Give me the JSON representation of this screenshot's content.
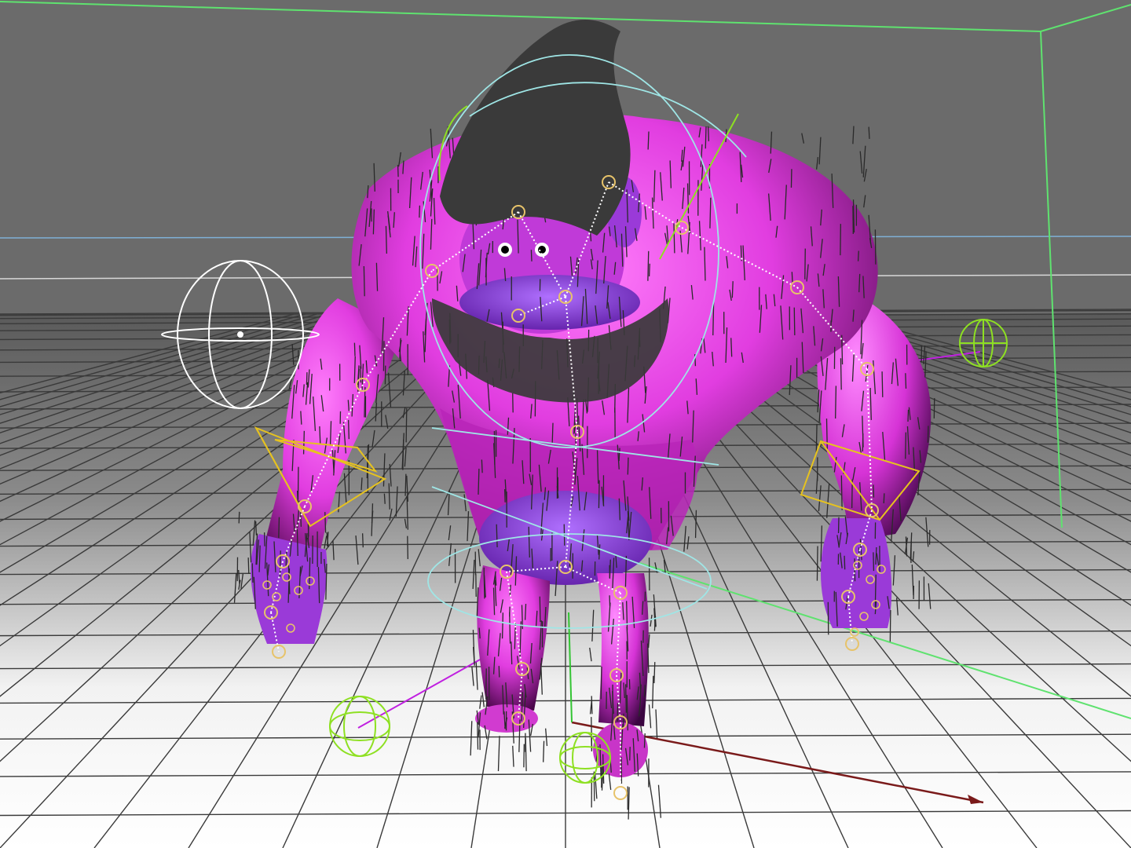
{
  "viewport": {
    "description_label": "",
    "colors": {
      "backdrop_wall": "#6a6a6a",
      "floor_far": "#5e5e5e",
      "floor_near": "#ffffff",
      "grid_line": "#3a3a3a",
      "character_skin": "#e13de0",
      "character_shadow": "#5a0a5a",
      "character_purple": "#8a2bd8",
      "fur": "#2a2a2a",
      "joint": "#e7c36a",
      "ik_handle": "#e6c21f",
      "controller_green": "#8ee022",
      "controller_white": "#ffffff",
      "controller_cyan": "#9fe6e6",
      "axis_x": "#7a1a1a",
      "axis_y": "#33c433",
      "boundary_green": "#5fe26f",
      "horizon_blue": "#7fb0d6",
      "magenta_line": "#c020e0"
    },
    "objects": [
      "character-mesh",
      "fur-system",
      "skeleton-joints",
      "head-controller",
      "torso-controller",
      "left-hand-ik-handle",
      "right-hand-ik-handle",
      "left-foot-controller",
      "right-foot-controller",
      "right-pole-vector-controller",
      "look-at-controller",
      "world-axis"
    ]
  }
}
